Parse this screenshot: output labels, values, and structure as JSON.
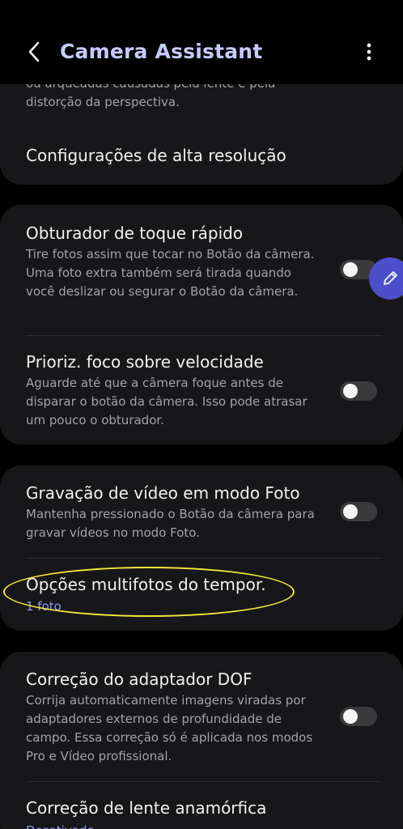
{
  "header": {
    "title": "Camera Assistant",
    "back_icon": "chevron-left-icon",
    "more_icon": "more-vertical-icon"
  },
  "card1": {
    "partial_desc_line1": "ou arqueadas causadas pela lente e pela",
    "partial_desc_line2": "distorção da perspectiva.",
    "high_res_title": "Configurações de alta resolução"
  },
  "card2": {
    "quick_shutter": {
      "title": "Obturador de toque rápido",
      "desc": "Tire fotos assim que tocar no Botão da câmera. Uma foto extra também será tirada quando você deslizar ou segurar o Botão da câmera.",
      "enabled": false
    },
    "focus_priority": {
      "title": "Prioriz. foco sobre velocidade",
      "desc": "Aguarde até que a câmera foque antes de disparar o botão da câmera. Isso pode atrasar um pouco o obturador.",
      "enabled": false
    }
  },
  "card3": {
    "video_photo_mode": {
      "title": "Gravação de vídeo em modo Foto",
      "desc": "Mantenha pressionado o Botão da câmera para gravar vídeos no modo Foto.",
      "enabled": false
    },
    "timer_multishot": {
      "title": "Opções multifotos do tempor.",
      "value": "1 foto"
    }
  },
  "card4": {
    "dof_correction": {
      "title": "Correção do adaptador DOF",
      "desc": "Corrija automaticamente imagens viradas por adaptadores externos de profundidade de campo. Essa correção só é aplicada nos modos Pro e Vídeo profissional.",
      "enabled": false
    },
    "anamorphic": {
      "title": "Correção de lente anamórfica",
      "value": "Desativado"
    }
  },
  "colors": {
    "title_accent": "#c5cbff",
    "subvalue_accent": "#8d98f5",
    "card_bg": "#171719",
    "highlight": "#f2e93a",
    "fab_bg": "#4c4fc9"
  },
  "floating_icon": "pencil-icon"
}
